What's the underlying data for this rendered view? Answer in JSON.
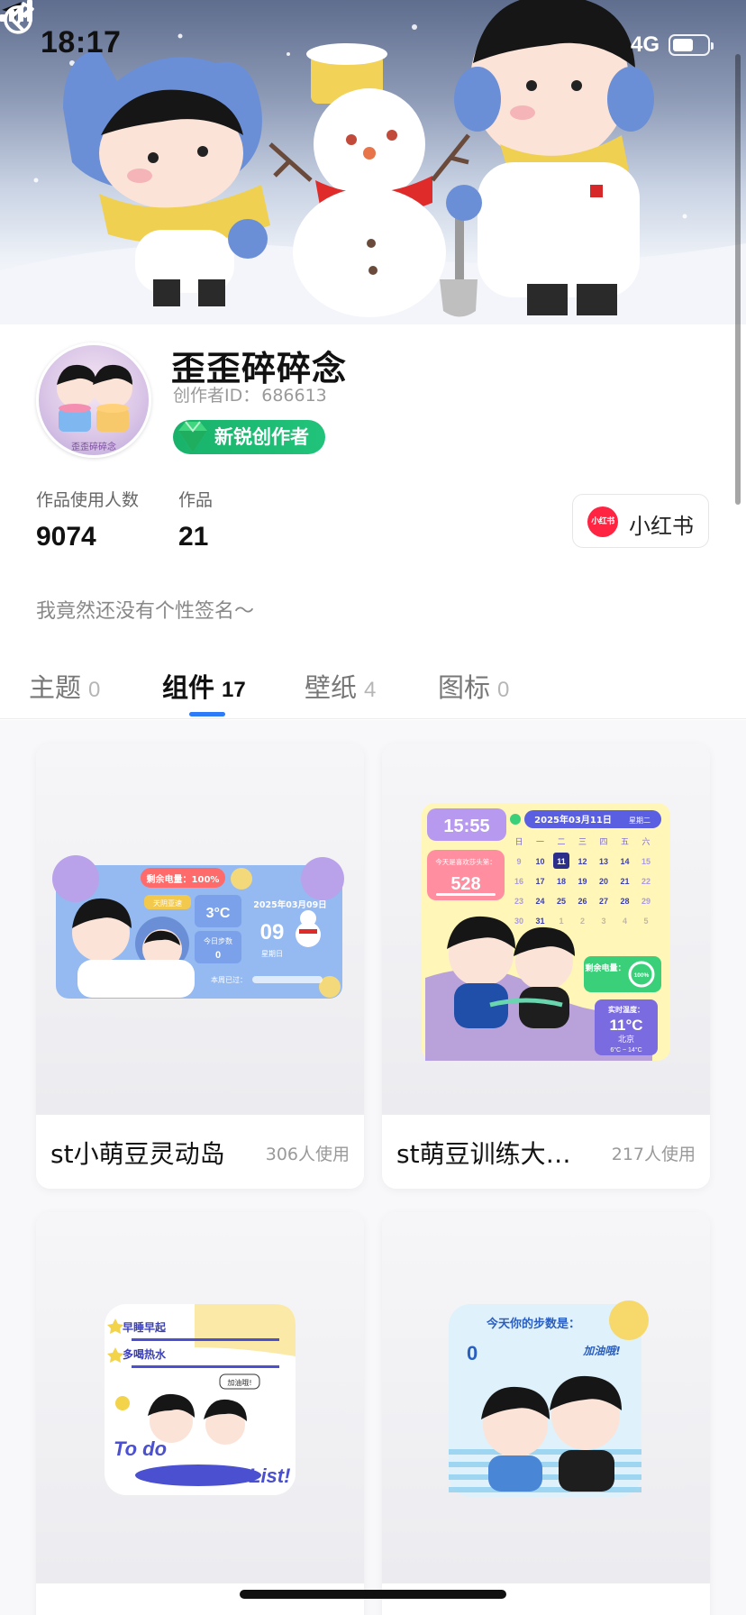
{
  "status_bar": {
    "time": "18:17",
    "network": "4G"
  },
  "profile": {
    "name": "歪歪碎碎念",
    "creator_id_label": "创作者ID：",
    "creator_id": "686613",
    "badge": "新锐创作者",
    "avatar_caption": "歪歪碎碎念",
    "signature": "我竟然还没有个性签名～"
  },
  "stats": [
    {
      "label": "作品使用人数",
      "value": "9074"
    },
    {
      "label": "作品",
      "value": "21"
    }
  ],
  "xhs_button": {
    "logo_text": "小红书",
    "label": "小红书"
  },
  "tabs": [
    {
      "label": "主题",
      "count": "0",
      "active": false
    },
    {
      "label": "组件",
      "count": "17",
      "active": true
    },
    {
      "label": "壁纸",
      "count": "4",
      "active": false
    },
    {
      "label": "图标",
      "count": "0",
      "active": false
    }
  ],
  "cards": [
    {
      "title": "st小萌豆灵动岛",
      "uses": "306人使用",
      "widget": {
        "battery": "剩余电量：100%",
        "weather_tag": "天阴亚速",
        "temp": "3°C",
        "date": "2025年03月09日",
        "day": "09",
        "weekday": "星期日",
        "steps_label": "今日步数",
        "steps": "0",
        "week_label": "本周已过："
      }
    },
    {
      "title": "st萌豆训练大组...",
      "uses": "217人使用",
      "widget": {
        "time": "15:55",
        "date": "2025年03月11日",
        "weekday": "星期二",
        "week_headers": [
          "日",
          "一",
          "二",
          "三",
          "四",
          "五",
          "六"
        ],
        "days": [
          "9",
          "10",
          "11",
          "12",
          "13",
          "14",
          "15",
          "16",
          "17",
          "18",
          "19",
          "20",
          "21",
          "22",
          "23",
          "24",
          "25",
          "26",
          "27",
          "28",
          "29",
          "30",
          "31",
          "1",
          "2",
          "3",
          "4",
          "5"
        ],
        "today": "11",
        "steps_label": "今天是喜欢莎头第：",
        "steps": "528",
        "battery_label": "剩余电量：",
        "battery": "100%",
        "weather_label": "实时温度：",
        "temp": "11°C",
        "city": "北京",
        "range": "6°C ~ 14°C"
      }
    },
    {
      "title": "",
      "uses": "",
      "widget": {
        "line1": "早睡早起",
        "line2": "多喝热水",
        "bubble": "加油哦!",
        "todo_left": "To do",
        "todo_right": "List!"
      }
    },
    {
      "title": "",
      "uses": "",
      "widget": {
        "title": "今天你的步数是：",
        "steps": "0",
        "bubble": "加油哦!"
      }
    }
  ]
}
